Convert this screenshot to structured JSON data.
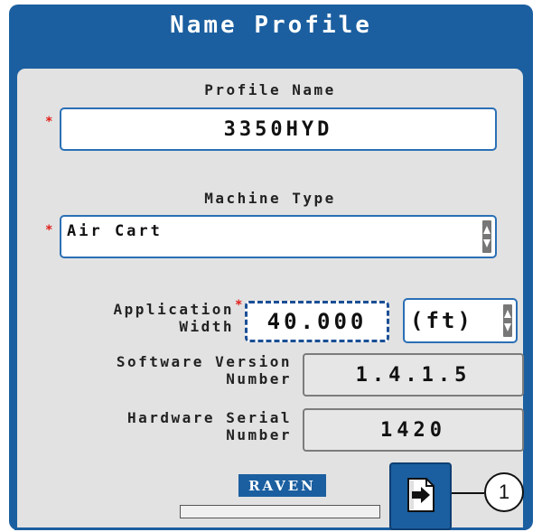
{
  "dialog": {
    "title": "Name Profile"
  },
  "profile_name": {
    "label": "Profile Name",
    "value": "3350HYD",
    "required_marker": "*"
  },
  "machine_type": {
    "label": "Machine Type",
    "value": "Air Cart",
    "required_marker": "*"
  },
  "application_width": {
    "label_line1": "Application",
    "label_line2": "Width",
    "required_marker": "*",
    "value": "40.000",
    "unit": "(ft)"
  },
  "software_version": {
    "label_line1": "Software Version",
    "label_line2": "Number",
    "value": "1.4.1.5"
  },
  "hardware_serial": {
    "label_line1": "Hardware Serial",
    "label_line2": "Number",
    "value": "1420"
  },
  "footer": {
    "brand": "RAVEN",
    "progress": 0,
    "next_icon": "next-page-icon"
  },
  "callout": {
    "label": "1"
  },
  "colors": {
    "frame": "#1b5fa0",
    "panel": "#e2e2e2",
    "required": "#e0201c"
  }
}
